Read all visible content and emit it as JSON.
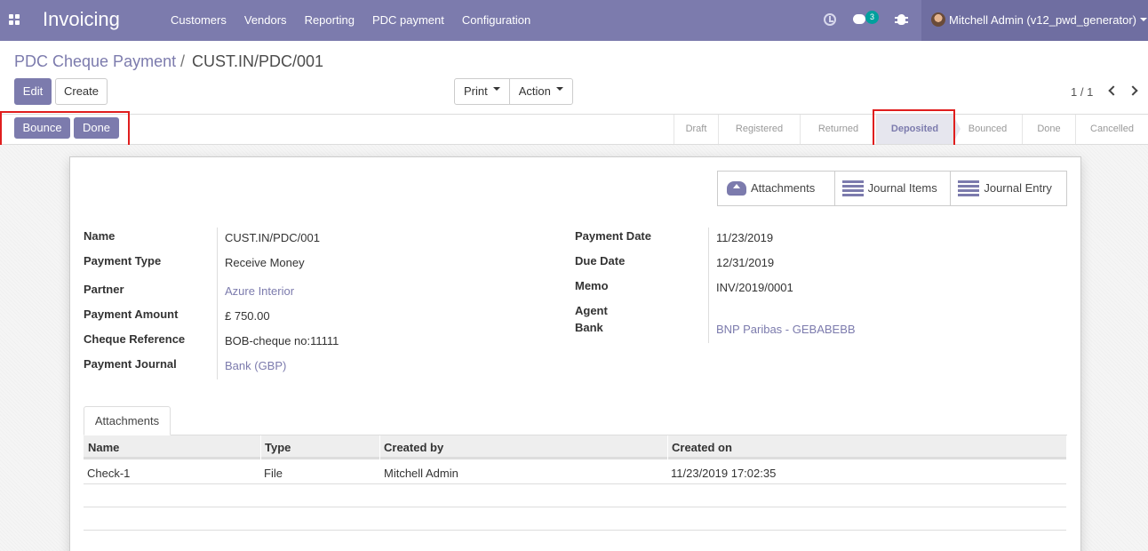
{
  "navbar": {
    "app_name": "Invoicing",
    "menu": [
      "Customers",
      "Vendors",
      "Reporting",
      "PDC payment",
      "Configuration"
    ],
    "messages_count": "3",
    "user": "Mitchell Admin (v12_pwd_generator)"
  },
  "breadcrumb": {
    "parent": "PDC Cheque Payment",
    "separator": "/",
    "current": "CUST.IN/PDC/001"
  },
  "toolbar": {
    "edit": "Edit",
    "create": "Create",
    "print": "Print",
    "action": "Action",
    "pager": "1 / 1"
  },
  "status_buttons": {
    "bounce": "Bounce",
    "done": "Done"
  },
  "stages": [
    "Draft",
    "Registered",
    "Returned",
    "Deposited",
    "Bounced",
    "Done",
    "Cancelled"
  ],
  "active_stage": "Deposited",
  "smart_buttons": {
    "attachments": "Attachments",
    "journal_items": "Journal Items",
    "journal_entry": "Journal Entry"
  },
  "fields_left": {
    "name_label": "Name",
    "name": "CUST.IN/PDC/001",
    "payment_type_label": "Payment Type",
    "payment_type": "Receive Money",
    "partner_label": "Partner",
    "partner": "Azure Interior",
    "amount_label": "Payment Amount",
    "amount": "£ 750.00",
    "cheque_ref_label": "Cheque Reference",
    "cheque_ref": "BOB-cheque no:11111",
    "journal_label": "Payment Journal",
    "journal": "Bank (GBP)"
  },
  "fields_right": {
    "payment_date_label": "Payment Date",
    "payment_date": "11/23/2019",
    "due_date_label": "Due Date",
    "due_date": "12/31/2019",
    "memo_label": "Memo",
    "memo": "INV/2019/0001",
    "agent_label": "Agent",
    "bank_label": "Bank",
    "bank": "BNP Paribas - GEBABEBB"
  },
  "attachments_tab": {
    "tab_label": "Attachments",
    "columns": [
      "Name",
      "Type",
      "Created by",
      "Created on"
    ],
    "rows": [
      {
        "name": "Check-1",
        "type": "File",
        "created_by": "Mitchell Admin",
        "created_on": "11/23/2019 17:02:35"
      }
    ]
  },
  "colors": {
    "brand": "#7c7bad",
    "highlight_box": "#e01e1e",
    "active_stage_bg": "#e6e6ee"
  }
}
